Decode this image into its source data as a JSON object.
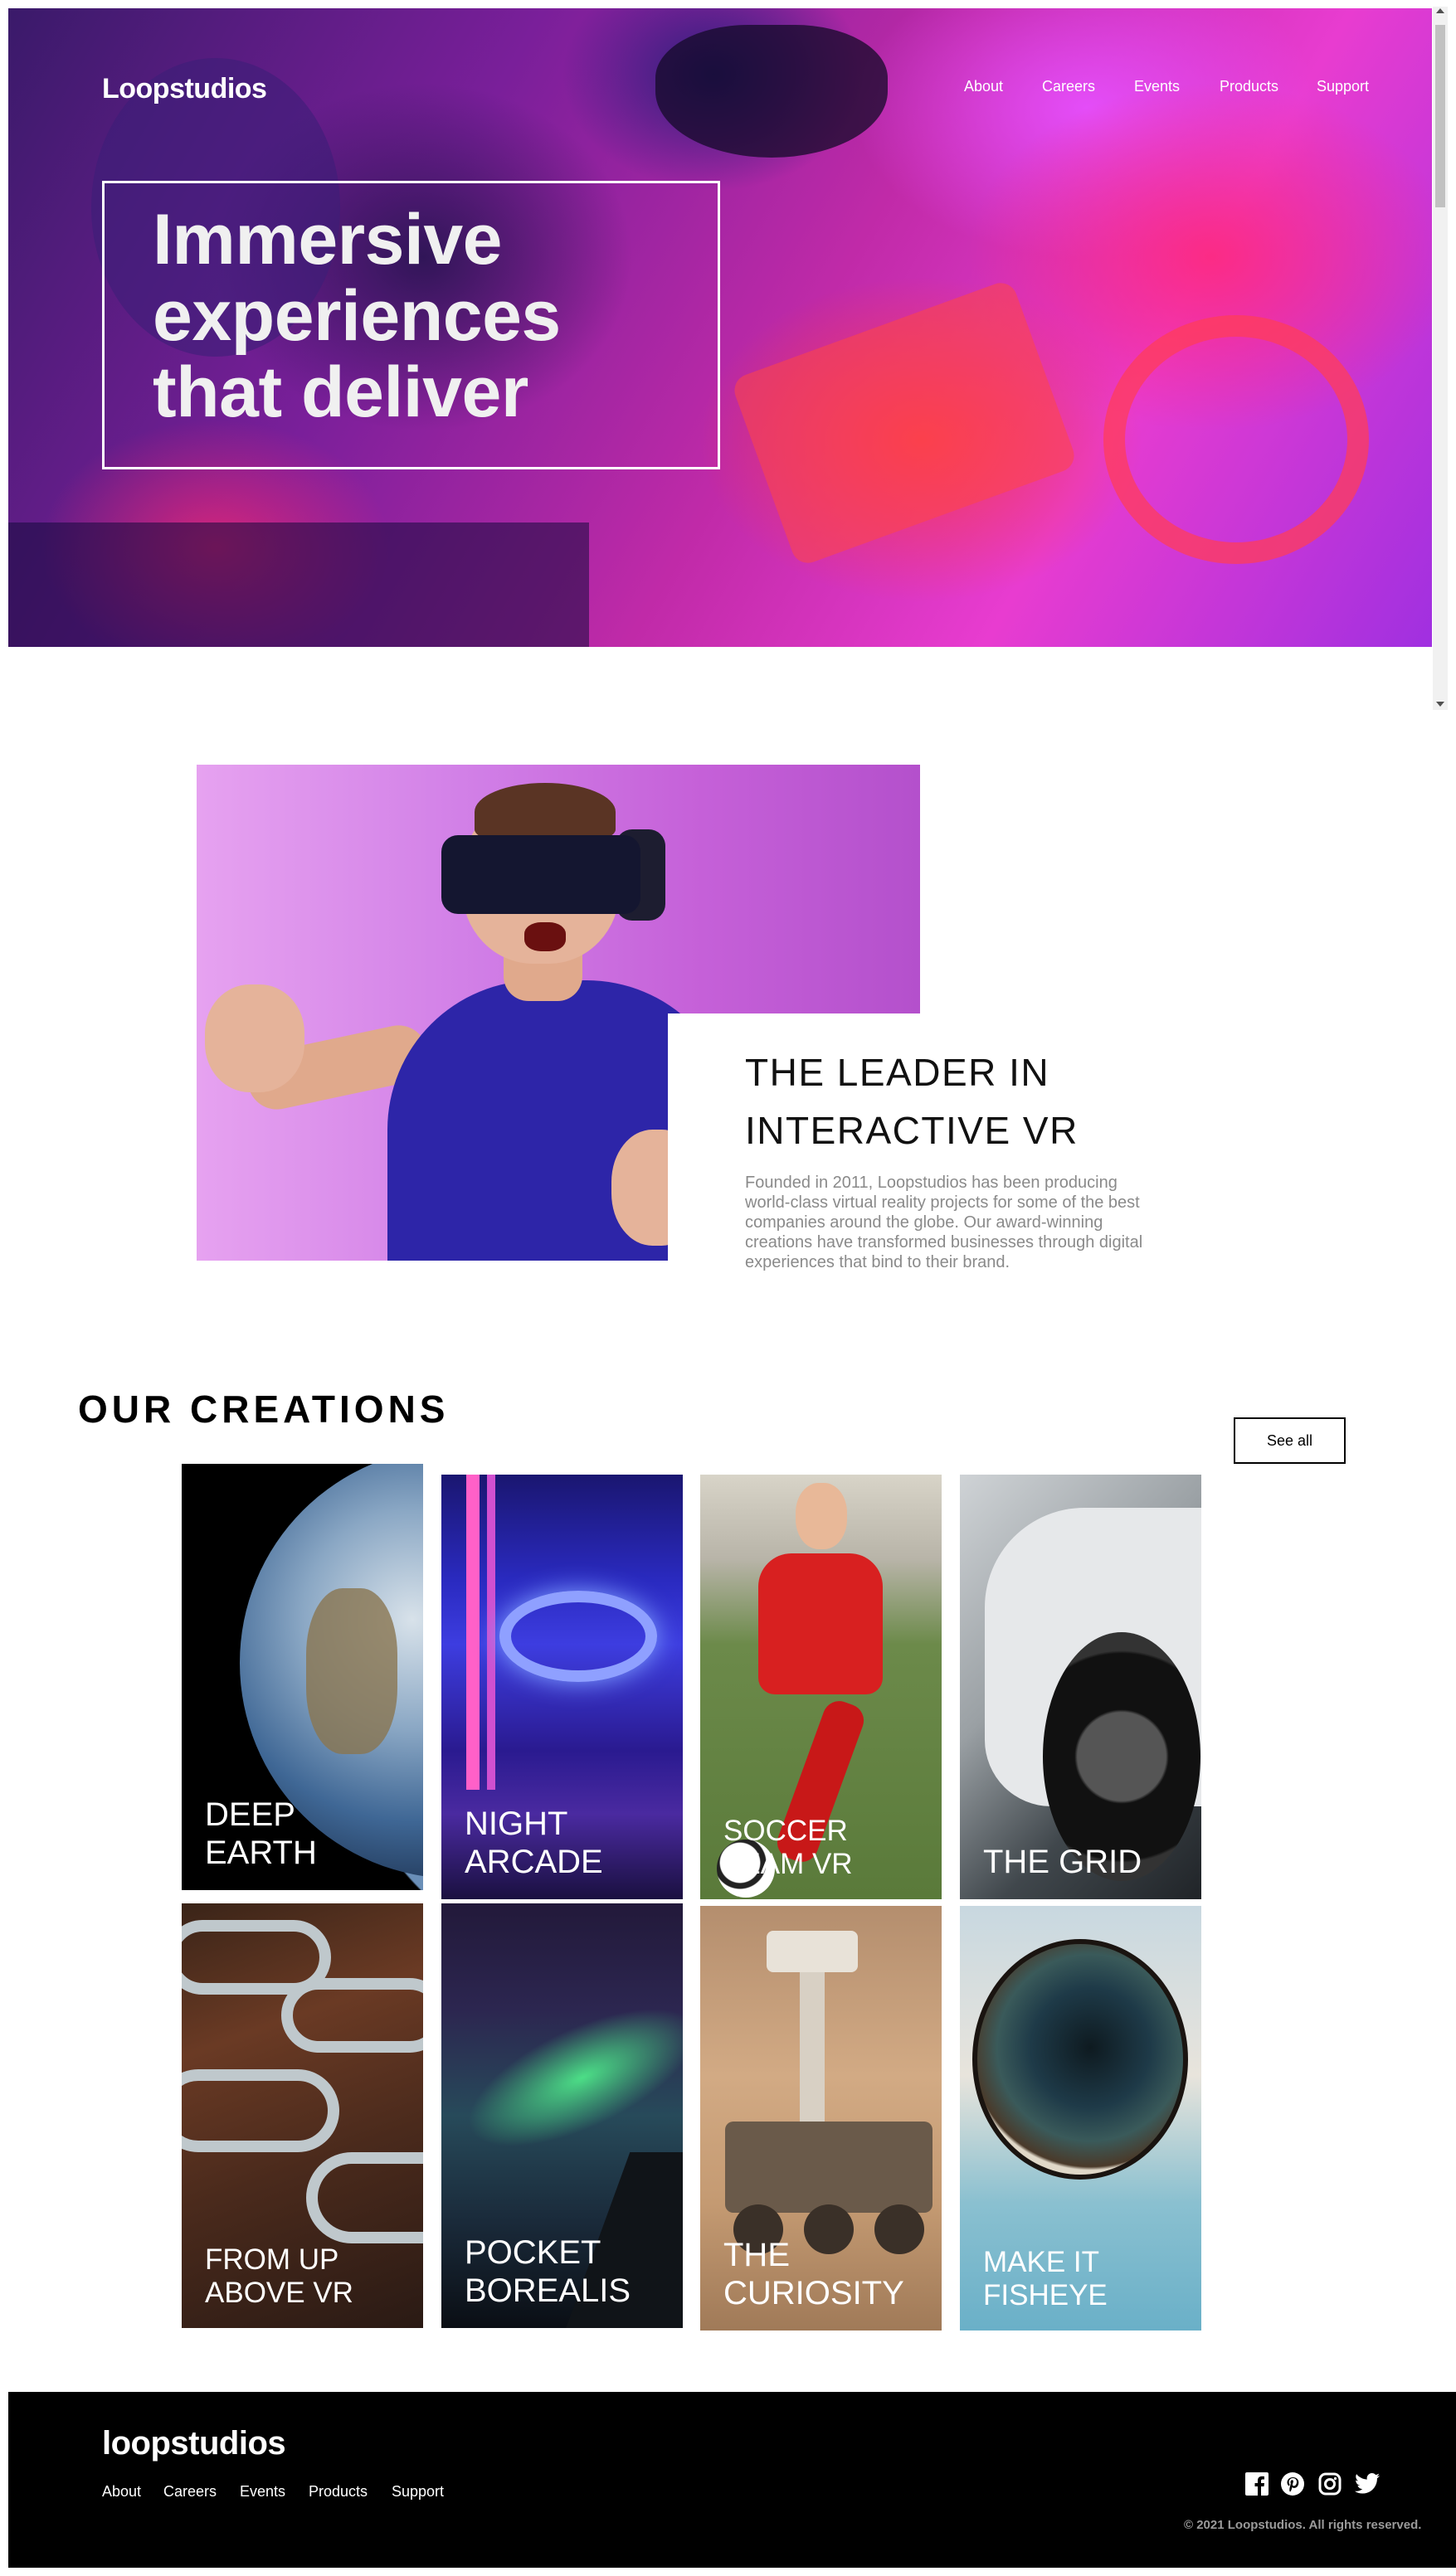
{
  "header": {
    "logo": "Loopstudios",
    "nav": [
      "About",
      "Careers",
      "Events",
      "Products",
      "Support"
    ]
  },
  "hero": {
    "headline": "Immersive experiences that deliver"
  },
  "intro": {
    "title": "THE LEADER IN INTERACTIVE VR",
    "text": "Founded in 2011, Loopstudios has been producing world-class virtual reality projects for some of the best companies around the globe. Our award-winning creations have transformed businesses through digital experiences that bind to their brand."
  },
  "creations": {
    "title": "OUR CREATIONS",
    "see_all": "See all",
    "items": [
      {
        "label": "DEEP EARTH"
      },
      {
        "label": "NIGHT ARCADE"
      },
      {
        "label": "SOCCER TEAM VR"
      },
      {
        "label": "THE GRID"
      },
      {
        "label": "FROM UP ABOVE VR"
      },
      {
        "label": "POCKET BOREALIS"
      },
      {
        "label": "THE CURIOSITY"
      },
      {
        "label": "MAKE IT FISHEYE"
      }
    ]
  },
  "footer": {
    "logo": "loopstudios",
    "nav": [
      "About",
      "Careers",
      "Events",
      "Products",
      "Support"
    ],
    "socials": [
      "facebook-icon",
      "pinterest-icon",
      "instagram-icon",
      "twitter-icon"
    ],
    "copyright": "© 2021 Loopstudios. All rights reserved."
  }
}
